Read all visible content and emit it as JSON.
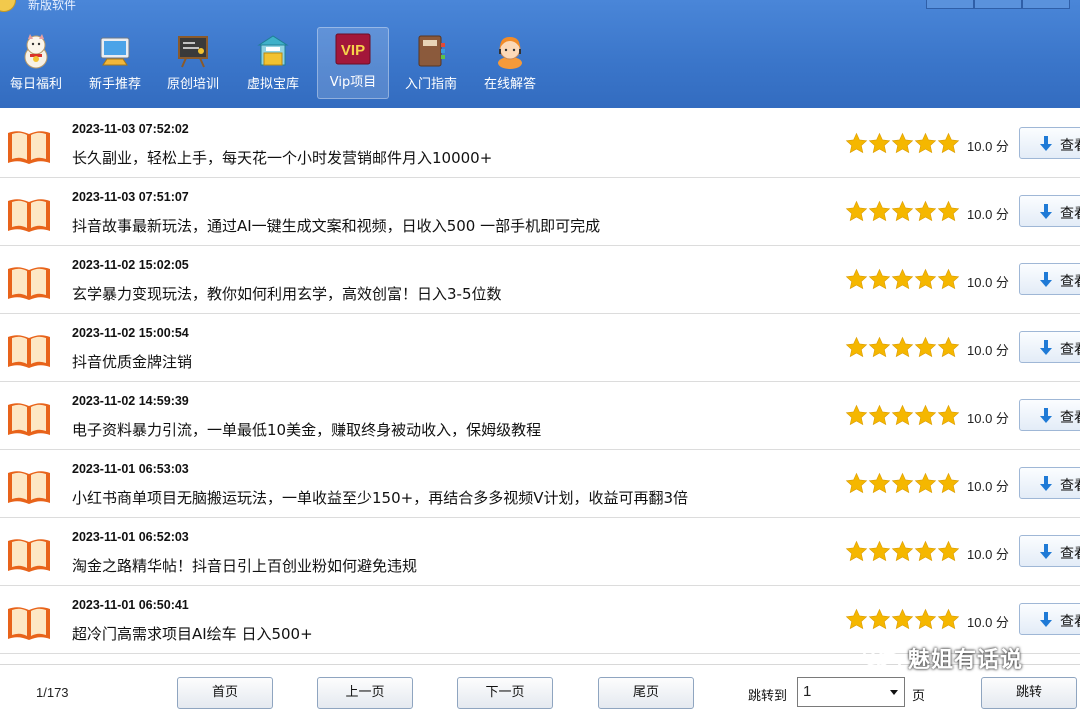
{
  "window": {
    "title": "新版软件"
  },
  "toolbar": {
    "items": [
      {
        "label": "每日福利",
        "icon": "lucky-cat-icon"
      },
      {
        "label": "新手推荐",
        "icon": "computer-icon"
      },
      {
        "label": "原创培训",
        "icon": "blackboard-icon"
      },
      {
        "label": "虚拟宝库",
        "icon": "treasure-shop-icon"
      },
      {
        "label": "Vip项目",
        "icon": "vip-icon",
        "badge": "VIP",
        "active": true
      },
      {
        "label": "入门指南",
        "icon": "guide-book-icon"
      },
      {
        "label": "在线解答",
        "icon": "customer-service-icon"
      }
    ]
  },
  "list": {
    "score_unit": "分",
    "view_label": "查看",
    "items": [
      {
        "date": "2023-11-03 07:52:02",
        "title": "长久副业，轻松上手，每天花一个小时发营销邮件月入10000+",
        "score": "10.0 分",
        "stars": 5
      },
      {
        "date": "2023-11-03 07:51:07",
        "title": "抖音故事最新玩法，通过AI一键生成文案和视频，日收入500 一部手机即可完成",
        "score": "10.0 分",
        "stars": 5
      },
      {
        "date": "2023-11-02 15:02:05",
        "title": "玄学暴力变现玩法，教你如何利用玄学，高效创富！日入3-5位数",
        "score": "10.0 分",
        "stars": 5
      },
      {
        "date": "2023-11-02 15:00:54",
        "title": "抖音优质金牌注销",
        "score": "10.0 分",
        "stars": 5
      },
      {
        "date": "2023-11-02 14:59:39",
        "title": "电子资料暴力引流，一单最低10美金，赚取终身被动收入，保姆级教程",
        "score": "10.0 分",
        "stars": 5
      },
      {
        "date": "2023-11-01 06:53:03",
        "title": "小红书商单项目无脑搬运玩法，一单收益至少150+，再结合多多视频V计划，收益可再翻3倍",
        "score": "10.0 分",
        "stars": 5
      },
      {
        "date": "2023-11-01 06:52:03",
        "title": "淘金之路精华帖！抖音日引上百创业粉如何避免违规",
        "score": "10.0 分",
        "stars": 5
      },
      {
        "date": "2023-11-01 06:50:41",
        "title": "超冷门高需求项目AI绘车 日入500+",
        "score": "10.0 分",
        "stars": 5
      }
    ]
  },
  "pager": {
    "page_info": "1/173",
    "first": "首页",
    "prev": "上一页",
    "next": "下一页",
    "last": "尾页",
    "jump_label": "跳转到",
    "jump_value": "1",
    "page_unit": "页",
    "jump_button": "跳转"
  },
  "watermark": {
    "text": "魅姐有话说"
  },
  "colors": {
    "header_blue": "#3a75c9",
    "star_gold": "#f5b700",
    "book_orange": "#e8631a",
    "download_blue": "#1f7ad6"
  }
}
